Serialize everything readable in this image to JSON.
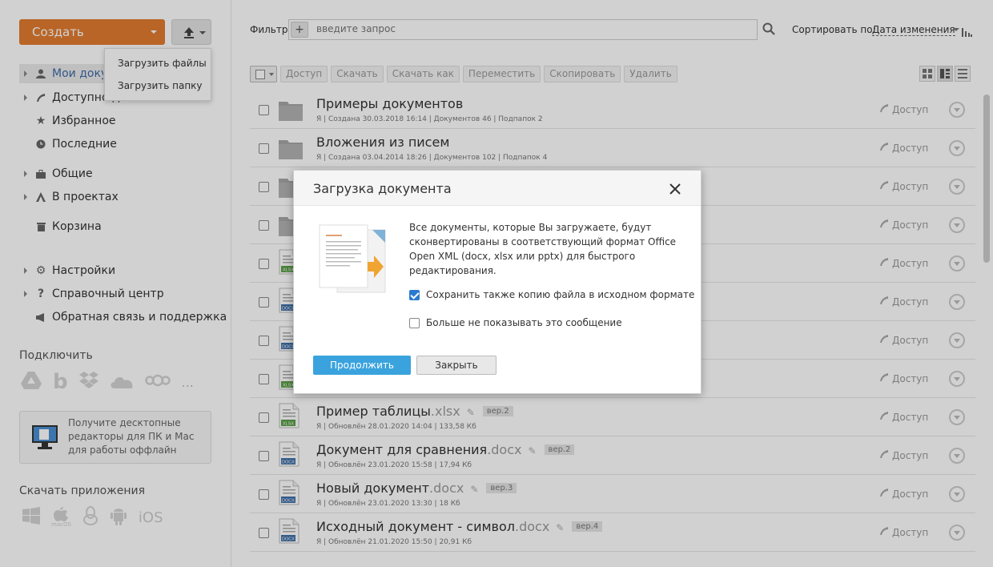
{
  "sidebar": {
    "create_label": "Создать",
    "upload_menu": [
      "Загрузить файлы",
      "Загрузить папку"
    ],
    "nav": {
      "my_docs": "Мои документы",
      "shared_with_me": "Доступно для меня",
      "favorites": "Избранное",
      "recent": "Последние",
      "common": "Общие",
      "projects": "В проектах",
      "trash": "Корзина",
      "settings": "Настройки",
      "help": "Справочный центр",
      "feedback": "Обратная связь и поддержка"
    },
    "connect_title": "Подключить",
    "connect_more": "...",
    "promo_text": "Получите десктопные редакторы для ПК и Mac для работы оффлайн",
    "apps_title": "Скачать приложения",
    "apps_macos": "macOS",
    "apps_ios": "iOS"
  },
  "header": {
    "filter_label": "Фильтр",
    "filter_placeholder": "введите запрос",
    "sort_label": "Сортировать по:",
    "sort_value": "Дата изменения"
  },
  "toolbar": [
    "Доступ",
    "Скачать",
    "Скачать как",
    "Переместить",
    "Скопировать",
    "Удалить"
  ],
  "access_label": "Доступ",
  "rows": [
    {
      "type": "folder",
      "name": "Примеры документов",
      "ext": "",
      "ver": "",
      "meta": "Я | Создана 30.03.2018 16:14 | Документов 46 | Подпапок 2"
    },
    {
      "type": "folder",
      "name": "Вложения из писем",
      "ext": "",
      "ver": "",
      "meta": "Я | Создана 03.04.2014 18:26 | Документов 102 | Подпапок 4"
    },
    {
      "type": "folder",
      "name": "",
      "ext": "",
      "ver": "",
      "meta": ""
    },
    {
      "type": "folder",
      "name": "",
      "ext": "",
      "ver": "",
      "meta": ""
    },
    {
      "type": "xlsx",
      "name": "",
      "ext": "",
      "ver": "",
      "meta": ""
    },
    {
      "type": "docx",
      "name": "",
      "ext": "",
      "ver": "",
      "meta": ""
    },
    {
      "type": "docx",
      "name": "",
      "ext": "",
      "ver": "",
      "meta": ""
    },
    {
      "type": "xlsx",
      "name": "",
      "ext": "",
      "ver": "",
      "meta": ""
    },
    {
      "type": "xlsx",
      "name": "Пример таблицы",
      "ext": ".xlsx",
      "ver": "вер.2",
      "meta": "Я | Обновлён 28.01.2020 14:04 | 133,58 Кб"
    },
    {
      "type": "docx",
      "name": "Документ для сравнения",
      "ext": ".docx",
      "ver": "вер.2",
      "meta": "Я | Обновлён 23.01.2020 15:58 | 17,94 Кб"
    },
    {
      "type": "docx",
      "name": "Новый документ",
      "ext": ".docx",
      "ver": "вер.3",
      "meta": "Я | Обновлён 23.01.2020 13:30 | 18 Кб"
    },
    {
      "type": "docx",
      "name": "Исходный документ - символ",
      "ext": ".docx",
      "ver": "вер.4",
      "meta": "Я | Обновлён 21.01.2020 15:50 | 20,91 Кб"
    }
  ],
  "modal": {
    "title": "Загрузка документа",
    "text": "Все документы, которые Вы загружаете, будут сконвертированы в соответствующий формат Office Open XML (docx, xlsx или pptx) для быстрого редактирования.",
    "keep_copy_label": "Сохранить также копию файла в исходном формате",
    "keep_copy_checked": true,
    "dont_show_label": "Больше не показывать это сообщение",
    "dont_show_checked": false,
    "continue_label": "Продолжить",
    "close_label": "Закрыть"
  },
  "colors": {
    "accent": "#e27c30",
    "link": "#3d6ba8",
    "primary_button": "#3aa3dd"
  }
}
